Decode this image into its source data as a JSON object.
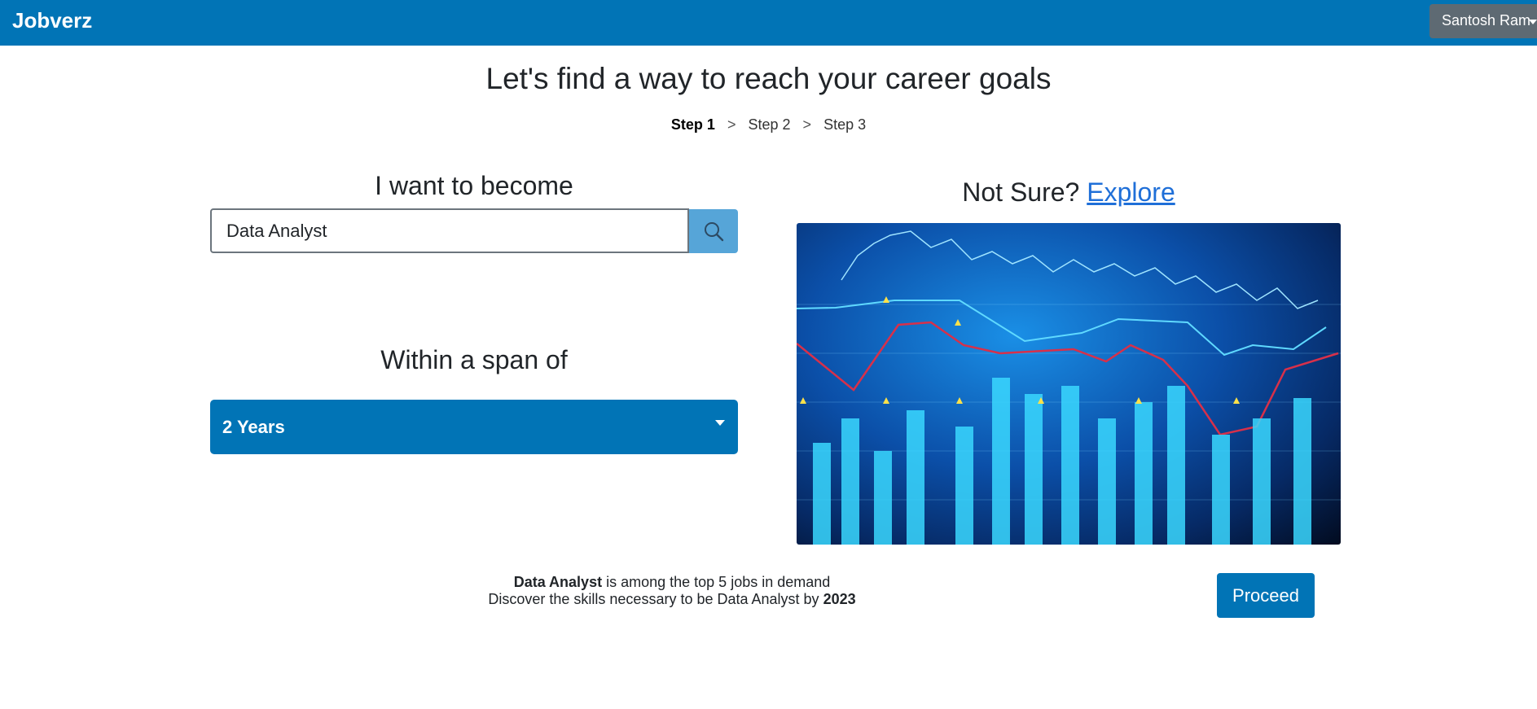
{
  "navbar": {
    "brand": "Jobverz",
    "user_name": "Santosh Ram",
    "background": "#0174b6"
  },
  "headline": "Let's find a way to reach your career goals",
  "steps": [
    {
      "label": "Step 1",
      "active": true
    },
    {
      "label": "Step 2",
      "active": false
    },
    {
      "label": "Step 3",
      "active": false
    }
  ],
  "step_separator": ">",
  "become": {
    "title": "I want to become",
    "value": "Data Analyst",
    "search_icon": "search-icon"
  },
  "span": {
    "title": "Within a span of",
    "selected": "2 Years"
  },
  "explore": {
    "prefix": "Not Sure?",
    "link_label": "Explore",
    "image": "stock-market-chart-image"
  },
  "summary": {
    "line1_role": "Data Analyst",
    "line1_rest": "is among the top 5 jobs in demand",
    "line2_text": "Discover the skills necessary to be Data Analyst by",
    "line2_year": "2023"
  },
  "proceed_label": "Proceed",
  "colors": {
    "primary": "#0174b6",
    "search_button": "#56a5d8",
    "link": "#1f6fd8",
    "user_menu": "#5e6a73"
  }
}
